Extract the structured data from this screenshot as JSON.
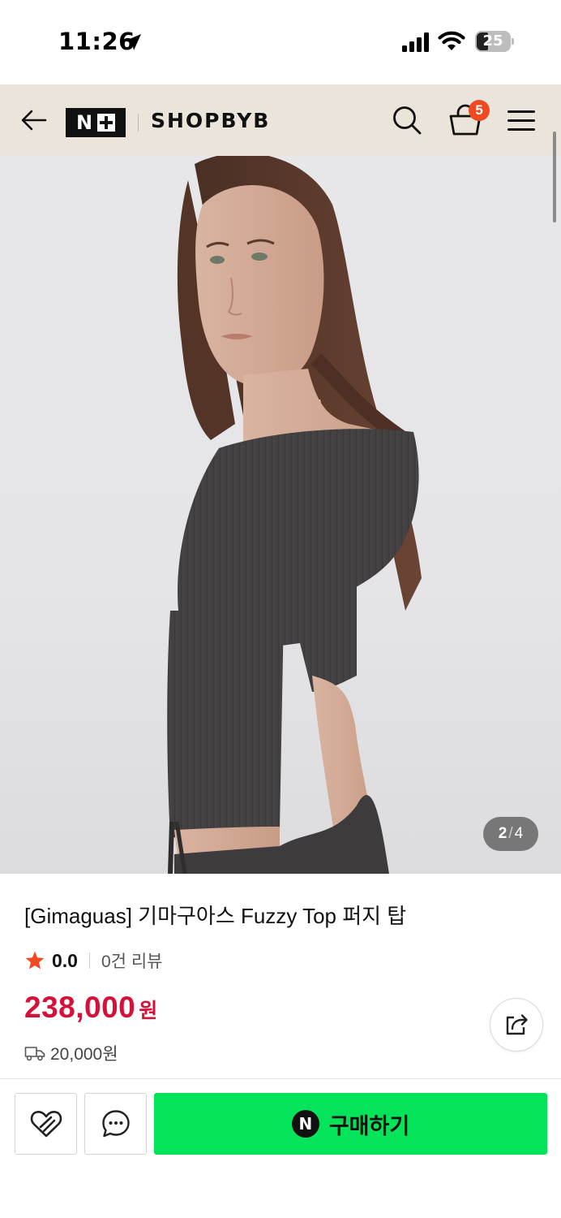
{
  "status_bar": {
    "time": "11:26",
    "battery": "25"
  },
  "header": {
    "logo_letter": "N",
    "brand": "SHOPBYB",
    "cart_count": "5"
  },
  "gallery": {
    "current": "2",
    "separator": "/",
    "total": "4"
  },
  "product": {
    "title": "[Gimaguas] 기마구아스 Fuzzy Top 퍼지 탑",
    "rating": "0.0",
    "review_count": "0건 리뷰",
    "price": "238,000",
    "price_unit": "원",
    "shipping_fee": "20,000원"
  },
  "actions": {
    "buy_icon_letter": "N",
    "buy_label": "구매하기"
  },
  "colors": {
    "header_bg": "#ebe4db",
    "price": "#d5113a",
    "buy_button": "#03e45a",
    "badge": "#f04a23",
    "star": "#f04a23"
  }
}
